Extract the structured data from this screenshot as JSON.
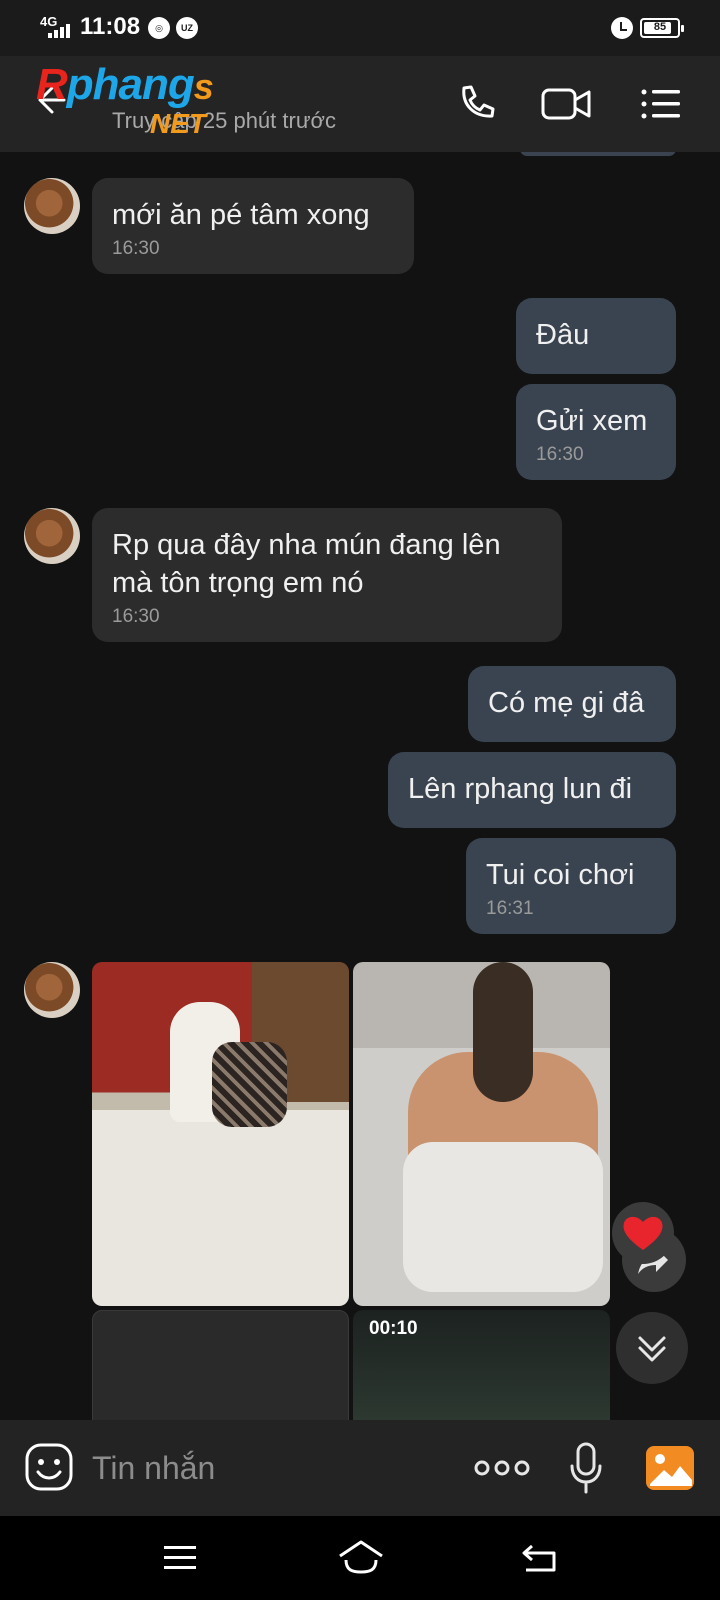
{
  "status_bar": {
    "network": "4G",
    "time": "11:08",
    "battery": "85",
    "battery_level": 0.85,
    "icons": [
      "signal-icon",
      "chrome-icon",
      "zalo-icon",
      "alarm-icon",
      "battery-icon"
    ]
  },
  "header": {
    "logo": {
      "r": "R",
      "main": "phang",
      "s": "s",
      "net": "NET"
    },
    "subtitle": "Truy cập 25 phút trước",
    "icons": [
      "back-arrow-icon",
      "phone-icon",
      "video-call-icon",
      "menu-list-icon"
    ]
  },
  "messages": [
    {
      "dir": "in",
      "text": "mới ăn pé tâm xong",
      "time": "16:30"
    },
    {
      "dir": "out",
      "text": "Đâu"
    },
    {
      "dir": "out",
      "text": "Gửi xem",
      "time": "16:30"
    },
    {
      "dir": "in",
      "text": "Rp qua đây nha mún đang lên\nmà tôn trọng em nó",
      "time": "16:30"
    },
    {
      "dir": "out",
      "text": "Có mẹ gi đâ"
    },
    {
      "dir": "out",
      "text": "Lên rphang lun đi"
    },
    {
      "dir": "out",
      "text": "Tui coi chơi",
      "time": "16:31"
    }
  ],
  "media": {
    "video_duration": "00:10"
  },
  "input": {
    "placeholder": "Tin nhắn"
  },
  "colors": {
    "background": "#121212",
    "incoming_bubble": "#2c2c2c",
    "outgoing_bubble": "#3a4450",
    "heart": "#e8252d",
    "gallery_accent": "#f28b21"
  }
}
